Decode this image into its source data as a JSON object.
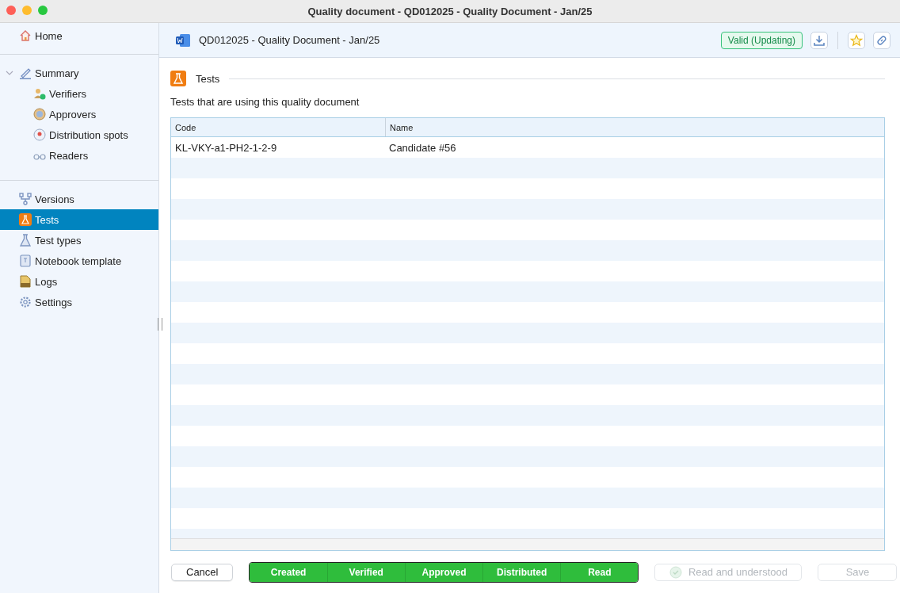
{
  "window": {
    "title": "Quality document - QD012025 - Quality Document - Jan/25"
  },
  "sidebar": {
    "home": {
      "label": "Home",
      "selected": false
    },
    "summary": {
      "label": "Summary",
      "expanded": true,
      "selected": false,
      "children": [
        {
          "label": "Verifiers",
          "kind": "verifier",
          "selected": false
        },
        {
          "label": "Approvers",
          "kind": "approver",
          "selected": false
        },
        {
          "label": "Distribution spots",
          "kind": "pin",
          "selected": false
        },
        {
          "label": "Readers",
          "kind": "glasses",
          "selected": false
        }
      ]
    },
    "items": [
      {
        "label": "Versions",
        "kind": "branch",
        "selected": false
      },
      {
        "label": "Tests",
        "kind": "flask-orange",
        "selected": true
      },
      {
        "label": "Test types",
        "kind": "flask",
        "selected": false
      },
      {
        "label": "Notebook template",
        "kind": "book",
        "selected": false
      },
      {
        "label": "Logs",
        "kind": "log",
        "selected": false
      },
      {
        "label": "Settings",
        "kind": "gear",
        "selected": false
      }
    ]
  },
  "header": {
    "document": "QD012025 - Quality Document - Jan/25",
    "status": "Valid (Updating)"
  },
  "section": {
    "title": "Tests",
    "description": "Tests that are using this quality document"
  },
  "table": {
    "columns": [
      "Code",
      "Name"
    ],
    "rows": [
      [
        "KL-VKY-a1-PH2-1-2-9",
        "Candidate #56"
      ]
    ]
  },
  "footer": {
    "cancel": "Cancel",
    "steps": [
      {
        "label": "Created",
        "completed": true
      },
      {
        "label": "Verified",
        "completed": true
      },
      {
        "label": "Approved",
        "completed": true
      },
      {
        "label": "Distributed",
        "completed": true
      },
      {
        "label": "Read",
        "completed": true
      }
    ],
    "read_button": {
      "label": "Read and understood",
      "disabled": true
    },
    "save_button": {
      "label": "Save",
      "disabled": true
    }
  }
}
